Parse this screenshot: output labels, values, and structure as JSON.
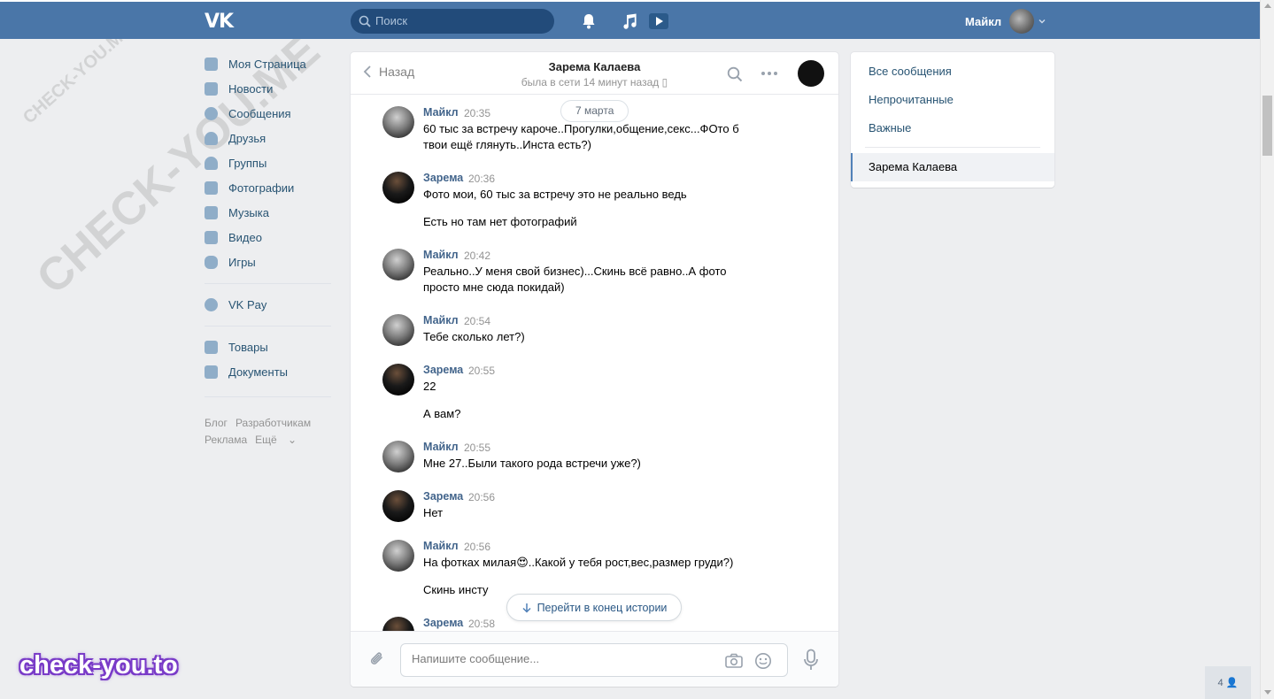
{
  "header": {
    "logo": "VK",
    "search_placeholder": "Поиск",
    "user_name": "Майкл"
  },
  "menu": {
    "items": [
      {
        "label": "Моя Страница",
        "icon": "home-icon"
      },
      {
        "label": "Новости",
        "icon": "news-icon"
      },
      {
        "label": "Сообщения",
        "icon": "messages-icon"
      },
      {
        "label": "Друзья",
        "icon": "friends-icon"
      },
      {
        "label": "Группы",
        "icon": "groups-icon"
      },
      {
        "label": "Фотографии",
        "icon": "photos-icon"
      },
      {
        "label": "Музыка",
        "icon": "music-icon"
      },
      {
        "label": "Видео",
        "icon": "video-icon"
      },
      {
        "label": "Игры",
        "icon": "games-icon"
      }
    ],
    "vkpay": "VK Pay",
    "items2": [
      {
        "label": "Товары",
        "icon": "market-icon"
      },
      {
        "label": "Документы",
        "icon": "documents-icon"
      }
    ],
    "footer": {
      "blog": "Блог",
      "dev": "Разработчикам",
      "ads": "Реклама",
      "more": "Ещё"
    }
  },
  "chat": {
    "back_label": "Назад",
    "peer_name": "Зарема Калаева",
    "peer_status": "была в сети 14 минут назад",
    "date_divider": "7 марта",
    "jump_to_end": "Перейти в конец истории",
    "composer_placeholder": "Напишите сообщение...",
    "messages": [
      {
        "author": "Майкл",
        "time": "20:35",
        "text": "60 тыс за встречу кароче..Прогулки,общение,секс...ФОто б твои ещё глянуть..Инста есть?)",
        "extra": ""
      },
      {
        "author": "Зарема",
        "time": "20:36",
        "text": "Фото мои, 60 тыс за встречу это не реально ведь",
        "extra": "Есть но там нет фотографий"
      },
      {
        "author": "Майкл",
        "time": "20:42",
        "text": "Реально..У меня свой бизнес)...Скинь всё равно..А фото просто мне сюда покидай)",
        "extra": ""
      },
      {
        "author": "Майкл",
        "time": "20:54",
        "text": "Тебе сколько лет?)",
        "extra": ""
      },
      {
        "author": "Зарема",
        "time": "20:55",
        "text": "22",
        "extra": "А вам?"
      },
      {
        "author": "Майкл",
        "time": "20:55",
        "text": "Мне 27..Были такого рода встречи уже?)",
        "extra": ""
      },
      {
        "author": "Зарема",
        "time": "20:56",
        "text": "Нет",
        "extra": ""
      },
      {
        "author": "Майкл",
        "time": "20:56",
        "text": "На фотках милая😍..Какой у тебя рост,вес,размер груди?)",
        "extra": "Скинь инсту"
      },
      {
        "author": "Зарема",
        "time": "20:58",
        "text": "",
        "extra": ""
      }
    ]
  },
  "side": {
    "all": "Все сообщения",
    "unread": "Непрочитанные",
    "important": "Важные",
    "active_dialog": "Зарема Калаева"
  },
  "watermark": {
    "text": "CHECK-YOU.ME",
    "brand": "check-you.to"
  },
  "online_count": "4",
  "colors": {
    "header": "#4a76a8",
    "link": "#42648b",
    "background": "#edeef0"
  }
}
